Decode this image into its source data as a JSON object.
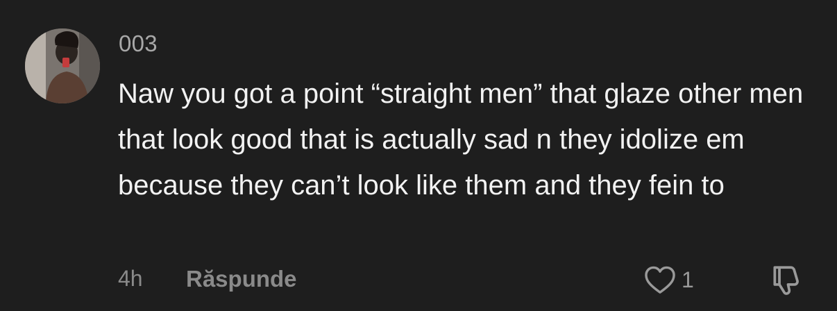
{
  "comment": {
    "username": "003",
    "text": "Naw you got a point “straight men” that glaze other men that look good that is actually sad n they idolize em because they can’t look like them and they fein to",
    "timestamp": "4h",
    "reply_label": "Răspunde",
    "like_count": "1",
    "icons": {
      "like": "heart-outline-icon",
      "dislike": "thumbs-down-outline-icon"
    }
  },
  "colors": {
    "background": "#1e1e1e",
    "text_primary": "#f2f2f2",
    "text_secondary": "#8a8a8a"
  }
}
